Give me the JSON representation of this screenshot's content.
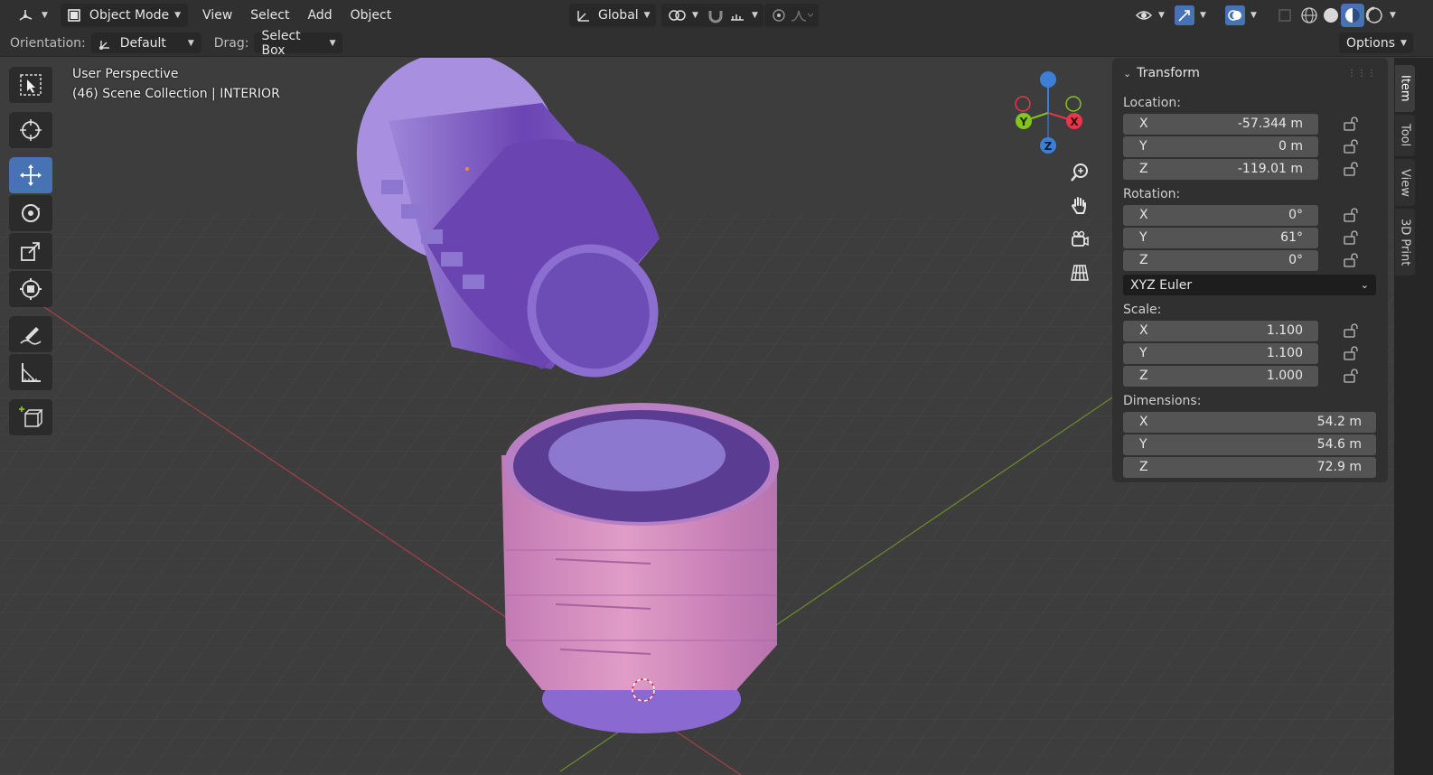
{
  "header": {
    "editor_type_icon": "3d-viewport-icon",
    "mode": "Object Mode",
    "menus": [
      "View",
      "Select",
      "Add",
      "Object"
    ],
    "transform_orientation": "Global"
  },
  "tool_settings": {
    "orientation_label": "Orientation:",
    "orientation_value": "Default",
    "drag_label": "Drag:",
    "drag_value": "Select Box",
    "options_label": "Options"
  },
  "viewport": {
    "perspective": "User Perspective",
    "collection": "(46) Scene Collection | INTERIOR"
  },
  "gizmo": {
    "x": "X",
    "y": "Y",
    "z": "Z"
  },
  "transform": {
    "title": "Transform",
    "location_label": "Location:",
    "location": [
      {
        "axis": "X",
        "value": "-57.344 m"
      },
      {
        "axis": "Y",
        "value": "0 m"
      },
      {
        "axis": "Z",
        "value": "-119.01 m"
      }
    ],
    "rotation_label": "Rotation:",
    "rotation": [
      {
        "axis": "X",
        "value": "0°"
      },
      {
        "axis": "Y",
        "value": "61°"
      },
      {
        "axis": "Z",
        "value": "0°"
      }
    ],
    "rotation_mode": "XYZ Euler",
    "scale_label": "Scale:",
    "scale": [
      {
        "axis": "X",
        "value": "1.100"
      },
      {
        "axis": "Y",
        "value": "1.100"
      },
      {
        "axis": "Z",
        "value": "1.000"
      }
    ],
    "dimensions_label": "Dimensions:",
    "dimensions": [
      {
        "axis": "X",
        "value": "54.2 m"
      },
      {
        "axis": "Y",
        "value": "54.6 m"
      },
      {
        "axis": "Z",
        "value": "72.9 m"
      }
    ]
  },
  "sidebar_tabs": [
    "Item",
    "Tool",
    "View",
    "3D Print"
  ],
  "colors": {
    "active_tool": "#4772b3",
    "axis_x": "#e8354c",
    "axis_y": "#83c41f",
    "axis_z": "#3c7fd6"
  }
}
